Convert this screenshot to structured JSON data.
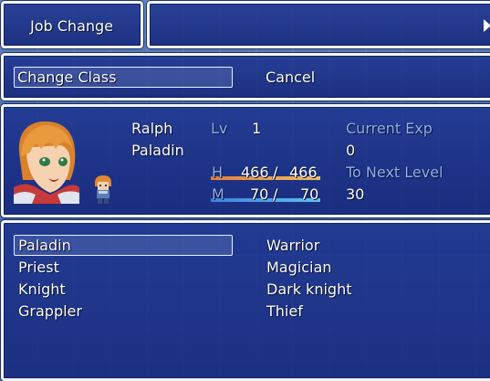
{
  "header": {
    "title": "Job Change"
  },
  "commands": {
    "change_class": "Change Class",
    "cancel": "Cancel"
  },
  "actor": {
    "name": "Ralph",
    "class": "Paladin",
    "level_label": "Lv",
    "level": "1",
    "current_exp_label": "Current Exp",
    "current_exp": "0",
    "next_level_label": "To Next Level",
    "next_level": "30",
    "hp_label": "H",
    "hp": "466",
    "hp_max": "466",
    "hp_ratio": 1.0,
    "mp_label": "M",
    "mp": "70",
    "mp_max": "70",
    "mp_ratio": 1.0,
    "separator": "/"
  },
  "classes": {
    "left": [
      "Paladin",
      "Priest",
      "Knight",
      "Grappler"
    ],
    "right": [
      "Warrior",
      "Magician",
      "Dark knight",
      "Thief"
    ],
    "selected": "Paladin"
  },
  "colors": {
    "hp_gauge_start": "#e08040",
    "hp_gauge_end": "#f0c060",
    "mp_gauge_start": "#4080e0",
    "mp_gauge_end": "#60c0f0",
    "system_text": "#8db0ec"
  }
}
